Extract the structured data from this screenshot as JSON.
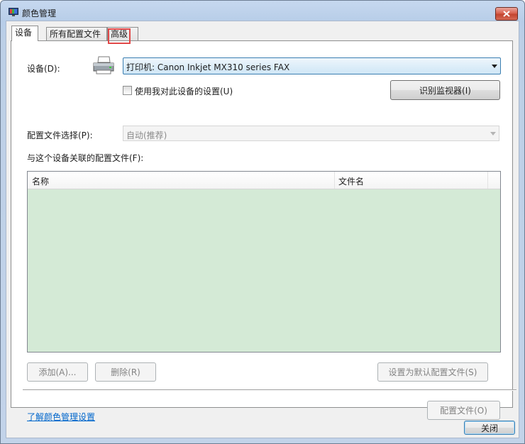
{
  "window": {
    "title": "颜色管理",
    "close_label": "关闭"
  },
  "tabs": [
    {
      "label": "设备",
      "active": true
    },
    {
      "label": "所有配置文件",
      "active": false
    },
    {
      "label": "高级",
      "active": false,
      "highlighted": true
    }
  ],
  "device_section": {
    "device_label": "设备(D):",
    "device_value": "打印机: Canon Inkjet MX310 series FAX",
    "use_my_settings_label": "使用我对此设备的设置(U)",
    "use_my_settings_checked": false,
    "identify_monitors_button": "识别监视器(I)",
    "profile_selection_label": "配置文件选择(P):",
    "profile_selection_value": "自动(推荐)",
    "associated_profiles_label": "与这个设备关联的配置文件(F):"
  },
  "profiles_table": {
    "columns": [
      "名称",
      "文件名"
    ],
    "rows": []
  },
  "actions": {
    "add_button": "添加(A)...",
    "remove_button": "删除(R)",
    "set_default_button": "设置为默认配置文件(S)",
    "profiles_button": "配置文件(O)"
  },
  "footer": {
    "learn_link": "了解颜色管理设置"
  }
}
